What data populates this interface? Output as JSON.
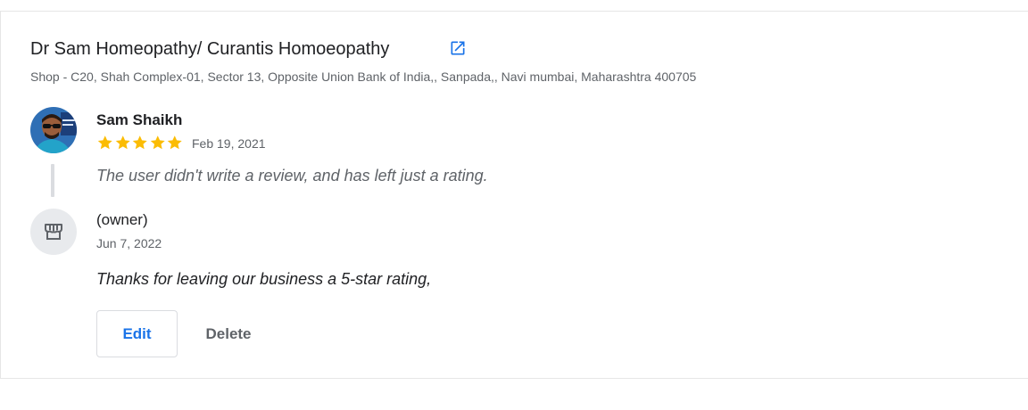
{
  "business": {
    "name": "Dr Sam Homeopathy/ Curantis Homoeopathy",
    "address": "Shop - C20, Shah Complex-01, Sector 13, Opposite Union Bank of India,, Sanpada,, Navi mumbai, Maharashtra 400705",
    "link_icon": "open-in-new-icon"
  },
  "review": {
    "reviewer_name": "Sam Shaikh",
    "rating": 5,
    "rating_max": 5,
    "date": "Feb 19, 2021",
    "text": "The user didn't write a review, and has left just a rating.",
    "avatar_icon": "reviewer-avatar"
  },
  "reply": {
    "author_label": "(owner)",
    "date": "Jun 7, 2022",
    "text": "Thanks for leaving our business a 5-star rating,",
    "avatar_icon": "storefront-icon"
  },
  "actions": {
    "edit_label": "Edit",
    "delete_label": "Delete"
  },
  "colors": {
    "accent": "#1a73e8",
    "star": "#fbbc04",
    "muted_text": "#5f6368",
    "primary_text": "#202124"
  }
}
